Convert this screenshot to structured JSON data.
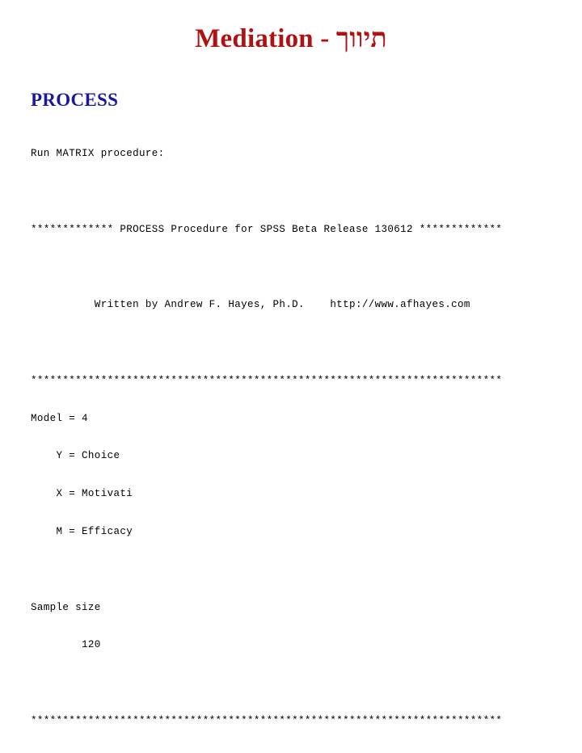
{
  "slide": {
    "title": "Mediation - תיווך",
    "title_color": "#AF1212",
    "heading": "PROCESS",
    "heading_color": "#191999",
    "background_color": "#ffffff"
  },
  "output": {
    "lines": [
      "Run MATRIX procedure:",
      "",
      "************* PROCESS Procedure for SPSS Beta Release 130612 *************",
      "",
      "          Written by Andrew F. Hayes, Ph.D.    http://www.afhayes.com",
      "",
      "**************************************************************************",
      "Model = 4",
      "    Y = Choice",
      "    X = Motivati",
      "    M = Efficacy",
      "",
      "Sample size",
      "        120",
      "",
      "**************************************************************************"
    ],
    "run_command": "Run MATRIX procedure:",
    "banner": "************* PROCESS Procedure for SPSS Beta Release 130612 *************",
    "author_line": "          Written by Andrew F. Hayes, Ph.D.    http://www.afhayes.com",
    "author_name": "Andrew F. Hayes, Ph.D.",
    "url": "http://www.afhayes.com",
    "release": "130612",
    "software": "SPSS Beta Release",
    "procedure_name": "PROCESS Procedure",
    "separator": "**************************************************************************",
    "model": {
      "model_label": "Model = 4",
      "model_number": "4",
      "y_label": "    Y = Choice",
      "y_variable": "Choice",
      "x_label": "    X = Motivati",
      "x_variable": "Motivati",
      "m_label": "    M = Efficacy",
      "m_variable": "Efficacy"
    },
    "sample": {
      "label": "Sample size",
      "value": "        120",
      "n": "120"
    }
  }
}
